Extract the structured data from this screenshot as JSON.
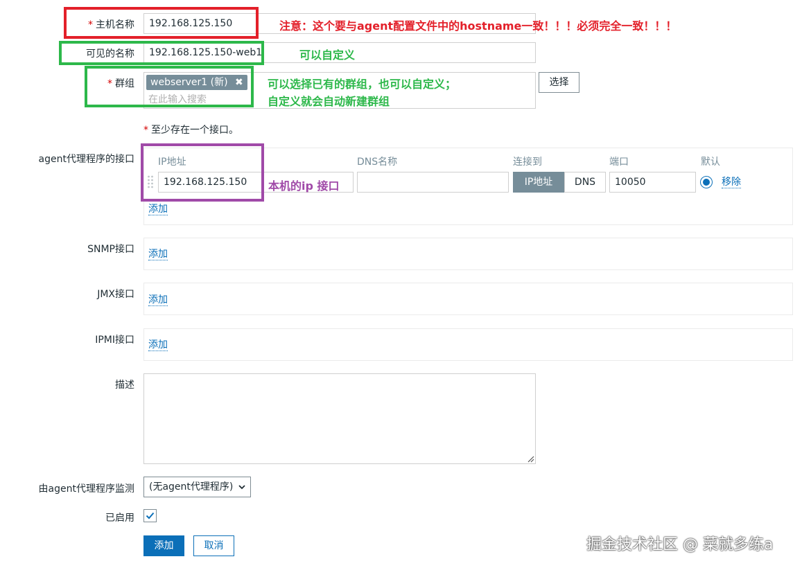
{
  "form": {
    "host_name": {
      "label": "主机名称",
      "value": "192.168.125.150"
    },
    "visible_name": {
      "label": "可见的名称",
      "value": "192.168.125.150-web1"
    },
    "groups": {
      "label": "群组",
      "tag": "webserver1 (新)",
      "placeholder": "在此输入搜索",
      "select_button": "选择"
    },
    "interface_notice": "至少存在一个接口。",
    "agent_interfaces": {
      "label": "agent代理程序的接口",
      "headers": {
        "ip": "IP地址",
        "dns": "DNS名称",
        "connect_to": "连接到",
        "port": "端口",
        "default": "默认"
      },
      "row": {
        "ip": "192.168.125.150",
        "dns": "",
        "connect_ip": "IP地址",
        "connect_dns": "DNS",
        "port": "10050",
        "remove": "移除"
      },
      "add": "添加"
    },
    "snmp": {
      "label": "SNMP接口",
      "add": "添加"
    },
    "jmx": {
      "label": "JMX接口",
      "add": "添加"
    },
    "ipmi": {
      "label": "IPMI接口",
      "add": "添加"
    },
    "description": {
      "label": "描述",
      "value": ""
    },
    "monitored_by_proxy": {
      "label": "由agent代理程序监测",
      "selected": "(无agent代理程序)"
    },
    "enabled": {
      "label": "已启用",
      "checked": true
    },
    "buttons": {
      "add": "添加",
      "cancel": "取消"
    }
  },
  "annotations": {
    "host_name_note": "注意：这个要与agent配置文件中的hostname一致！！！必须完全一致！！！",
    "visible_name_note": "可以自定义",
    "group_note_line1": "可以选择已有的群组，也可以自定义；",
    "group_note_line2": "自定义就会自动新建群组",
    "ip_note": "本机的ip 接口"
  },
  "watermark": "掘金技术社区 @ 菜就多练a",
  "colors": {
    "red_box": "#e3202a",
    "green_box": "#2db84a",
    "purple_box": "#a04aa8",
    "primary": "#0b6fb8"
  }
}
